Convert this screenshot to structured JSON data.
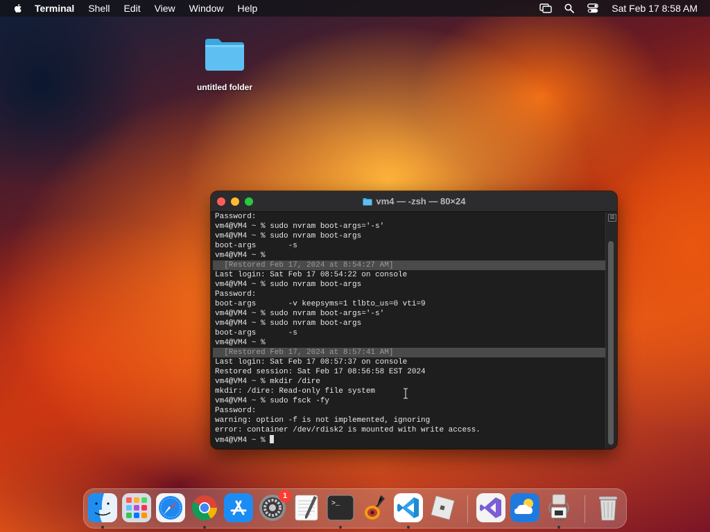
{
  "menubar": {
    "app_name": "Terminal",
    "items": [
      "Shell",
      "Edit",
      "View",
      "Window",
      "Help"
    ],
    "clock": "Sat Feb 17  8:58 AM",
    "status_icons": [
      "screen-mirroring-icon",
      "spotlight-search-icon",
      "control-center-icon"
    ]
  },
  "desktop": {
    "folder_label": "untitled folder"
  },
  "terminal": {
    "title": "vm4 — -zsh — 80×24",
    "lines": [
      "Password:",
      "vm4@VM4 ~ % sudo nvram boot-args='-s'",
      "vm4@VM4 ~ % sudo nvram boot-args",
      "boot-args\t-s",
      "vm4@VM4 ~ %",
      "  [Restored Feb 17, 2024 at 8:54:27 AM]",
      "Last login: Sat Feb 17 08:54:22 on console",
      "vm4@VM4 ~ % sudo nvram boot-args",
      "Password:",
      "boot-args\t-v keepsyms=1 tlbto_us=0 vti=9",
      "vm4@VM4 ~ % sudo nvram boot-args='-s'",
      "vm4@VM4 ~ % sudo nvram boot-args",
      "boot-args\t-s",
      "vm4@VM4 ~ %",
      "  [Restored Feb 17, 2024 at 8:57:41 AM]",
      "Last login: Sat Feb 17 08:57:37 on console",
      "Restored session: Sat Feb 17 08:56:58 EST 2024",
      "vm4@VM4 ~ % mkdir /dire",
      "mkdir: /dire: Read-only file system",
      "vm4@VM4 ~ % sudo fsck -fy",
      "Password:",
      "warning: option -f is not implemented, ignoring",
      "error: container /dev/rdisk2 is mounted with write access.",
      "vm4@VM4 ~ % "
    ]
  },
  "dock": {
    "items": [
      {
        "name": "Finder",
        "icon": "finder-icon",
        "running": true
      },
      {
        "name": "Launchpad",
        "icon": "launchpad-icon",
        "running": false
      },
      {
        "name": "Safari",
        "icon": "safari-icon",
        "running": false
      },
      {
        "name": "Google Chrome",
        "icon": "chrome-icon",
        "running": true
      },
      {
        "name": "App Store",
        "icon": "app-store-icon",
        "running": false
      },
      {
        "name": "System Settings",
        "icon": "system-settings-icon",
        "running": false,
        "badge": "1"
      },
      {
        "name": "TextEdit",
        "icon": "textedit-icon",
        "running": false
      },
      {
        "name": "Terminal",
        "icon": "terminal-icon",
        "running": true
      },
      {
        "name": "GarageBand",
        "icon": "garageband-icon",
        "running": false
      },
      {
        "name": "Visual Studio Code",
        "icon": "vscode-icon",
        "running": true
      },
      {
        "name": "Roblox",
        "icon": "roblox-icon",
        "running": false
      },
      {
        "name": "Visual Studio",
        "icon": "visual-studio-icon",
        "running": false
      },
      {
        "name": "Weather",
        "icon": "weather-icon",
        "running": false
      },
      {
        "name": "System Information",
        "icon": "system-information-icon",
        "running": true
      },
      {
        "name": "Trash",
        "icon": "trash-icon",
        "running": false
      }
    ]
  },
  "colors": {
    "terminal_bg": "#1e1e1e",
    "close": "#ff5f57",
    "minimize": "#febc2e",
    "maximize": "#28c840",
    "badge": "#ff3b30"
  }
}
